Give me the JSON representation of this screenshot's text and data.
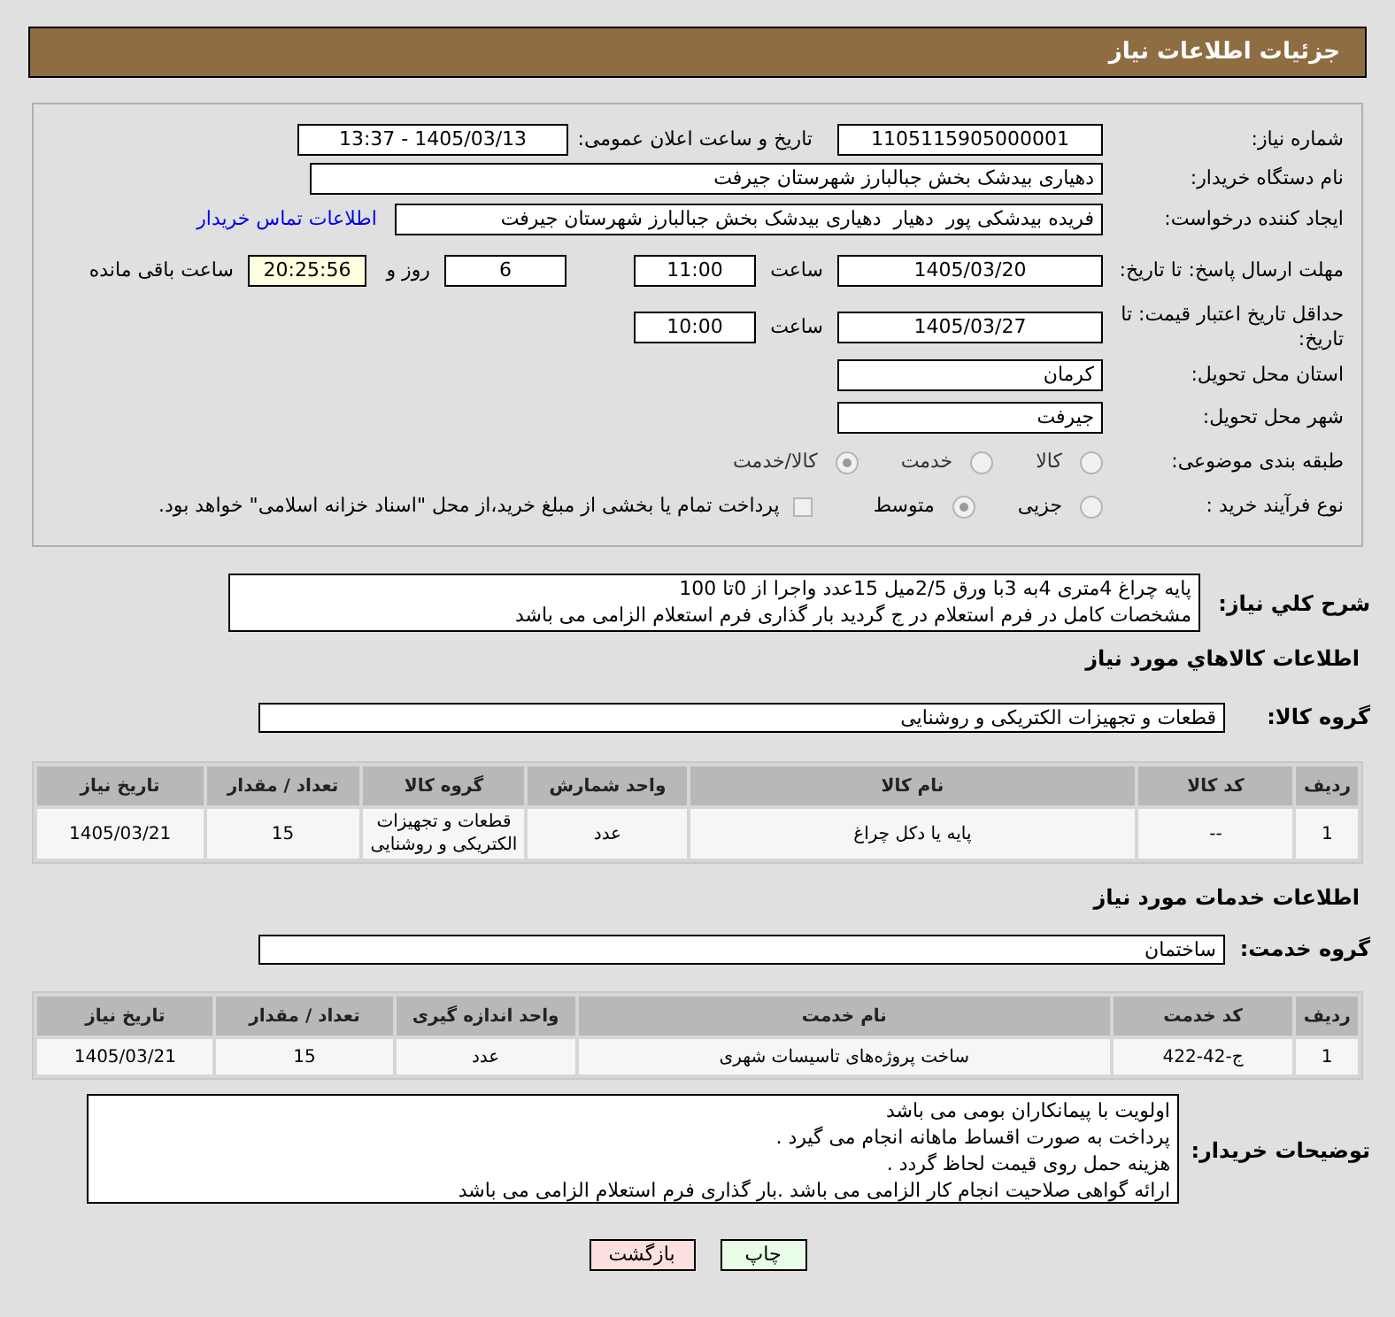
{
  "header": {
    "title": "جزئیات اطلاعات نیاز"
  },
  "need_number": {
    "label": "شماره نیاز:",
    "value": "1105115905000001"
  },
  "announce": {
    "label": "تاریخ و ساعت اعلان عمومی:",
    "value": "1405/03/13 - 13:37"
  },
  "buyer": {
    "label": "نام دستگاه خریدار:",
    "value": "دهیاری بیدشک بخش جبالبارز شهرستان جیرفت"
  },
  "requester": {
    "label": "ایجاد کننده درخواست:",
    "value": "فریده بیدشکی پور  دهیار  دهیاری بیدشک بخش جبالبارز شهرستان جیرفت",
    "link": "اطلاعات تماس خریدار"
  },
  "reply_deadline": {
    "label": "مهلت ارسال پاسخ: تا تاریخ:",
    "date": "1405/03/20",
    "time_label": "ساعت",
    "time": "11:00",
    "days": "6",
    "days_label": "روز و",
    "remaining": "20:25:56",
    "remaining_label": "ساعت باقی مانده"
  },
  "price_validity": {
    "label": "حداقل تاریخ اعتبار قیمت: تا تاریخ:",
    "date": "1405/03/27",
    "time_label": "ساعت",
    "time": "10:00"
  },
  "province": {
    "label": "استان محل تحویل:",
    "value": "کرمان"
  },
  "city": {
    "label": "شهر محل تحویل:",
    "value": "جیرفت"
  },
  "category": {
    "label": "طبقه بندی موضوعی:",
    "options": [
      {
        "label": "کالا",
        "selected": false
      },
      {
        "label": "خدمت",
        "selected": false
      },
      {
        "label": "کالا/خدمت",
        "selected": true
      }
    ]
  },
  "process": {
    "label": "نوع فرآیند خرید :",
    "options": [
      {
        "label": "جزیی",
        "selected": false
      },
      {
        "label": "متوسط",
        "selected": true
      }
    ],
    "payment": {
      "checked": false,
      "text": "پرداخت تمام یا بخشی از مبلغ خرید،از محل \"اسناد خزانه اسلامی\" خواهد بود."
    }
  },
  "description": {
    "label": "شرح کلي نياز:",
    "lines": [
      "پایه چراغ 4متری 4به 3با ورق 2/5میل 15عدد واجرا از 0تا 100",
      "مشخصات کامل در فرم استعلام در ج گردید بار گذاری فرم استعلام الزامی می باشد"
    ]
  },
  "goods": {
    "title": "اطلاعات كالاهاي مورد نياز",
    "group_label": "گروه کالا:",
    "group": "قطعات و تجهیزات الکتریکی و روشنایی",
    "columns": [
      "ردیف",
      "کد کالا",
      "نام کالا",
      "واحد شمارش",
      "گروه کالا",
      "تعداد / مقدار",
      "تاریخ نیاز"
    ],
    "rows": [
      [
        "1",
        "--",
        "پایه یا دکل چراغ",
        "عدد",
        "قطعات و تجهیزات الکتریکی و روشنایی",
        "15",
        "1405/03/21"
      ]
    ]
  },
  "services": {
    "title": "اطلاعات خدمات مورد نیاز",
    "group_label": "گروه خدمت:",
    "group": "ساختمان",
    "columns": [
      "ردیف",
      "کد خدمت",
      "نام خدمت",
      "واحد اندازه گیری",
      "تعداد / مقدار",
      "تاریخ نیاز"
    ],
    "rows": [
      [
        "1",
        "ج-42-422",
        "ساخت پروژه‌های تاسیسات شهری",
        "عدد",
        "15",
        "1405/03/21"
      ]
    ]
  },
  "buyer_notes": {
    "label": "توضیحات خریدار:",
    "lines": [
      "اولویت با پیمانکاران بومی می باشد",
      "پرداخت به صورت اقساط ماهانه انجام می گیرد .",
      "هزینه حمل روی قیمت لحاظ گردد .",
      "ارائه گواهی صلاحیت انجام کار الزامی می باشد .بار گذاری فرم استعلام الزامی می باشد"
    ]
  },
  "buttons": [
    {
      "label": "چاپ",
      "kind": "print"
    },
    {
      "label": "بازگشت",
      "kind": "back"
    }
  ]
}
